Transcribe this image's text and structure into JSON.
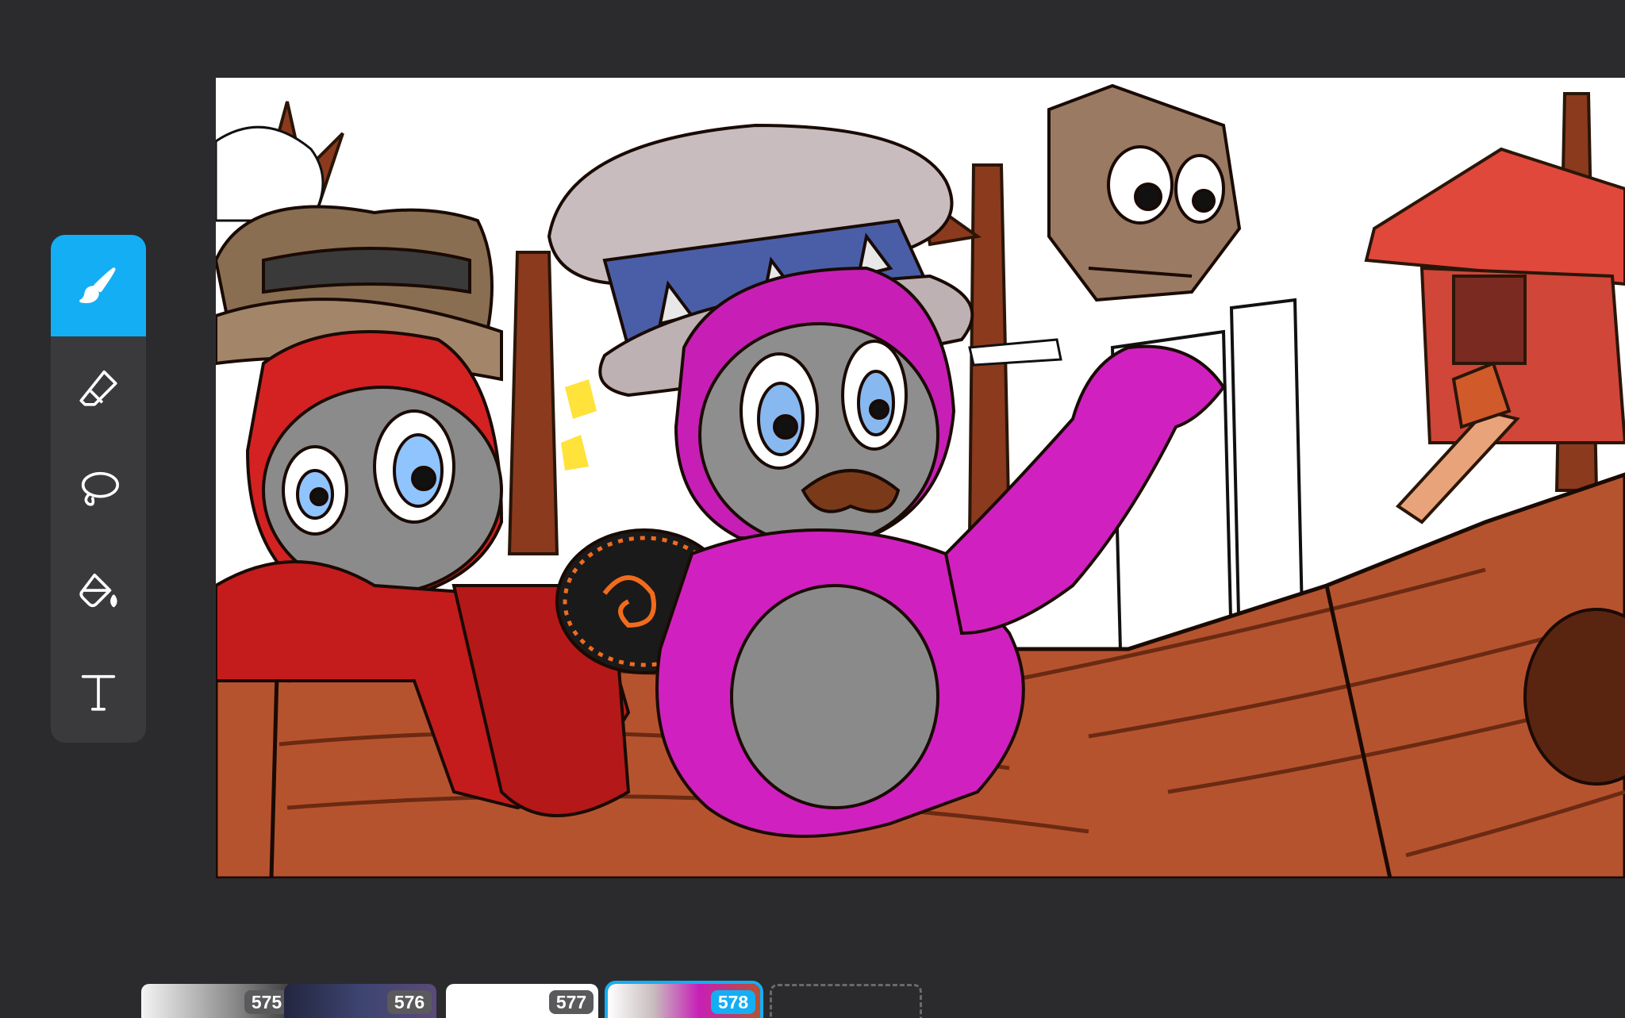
{
  "tools": [
    {
      "name": "brush",
      "icon": "brush-icon",
      "active": true
    },
    {
      "name": "eraser",
      "icon": "eraser-icon",
      "active": false
    },
    {
      "name": "lasso",
      "icon": "lasso-icon",
      "active": false
    },
    {
      "name": "fill",
      "icon": "paint-bucket-icon",
      "active": false
    },
    {
      "name": "text",
      "icon": "text-icon",
      "active": false
    }
  ],
  "frames": [
    {
      "number": "575",
      "active": false
    },
    {
      "number": "576",
      "active": false
    },
    {
      "number": "577",
      "active": false
    },
    {
      "number": "578",
      "active": true
    }
  ],
  "colors": {
    "background": "#2b2b2d",
    "panel": "#3a3a3c",
    "accent": "#14aef5",
    "canvas": "#ffffff"
  }
}
